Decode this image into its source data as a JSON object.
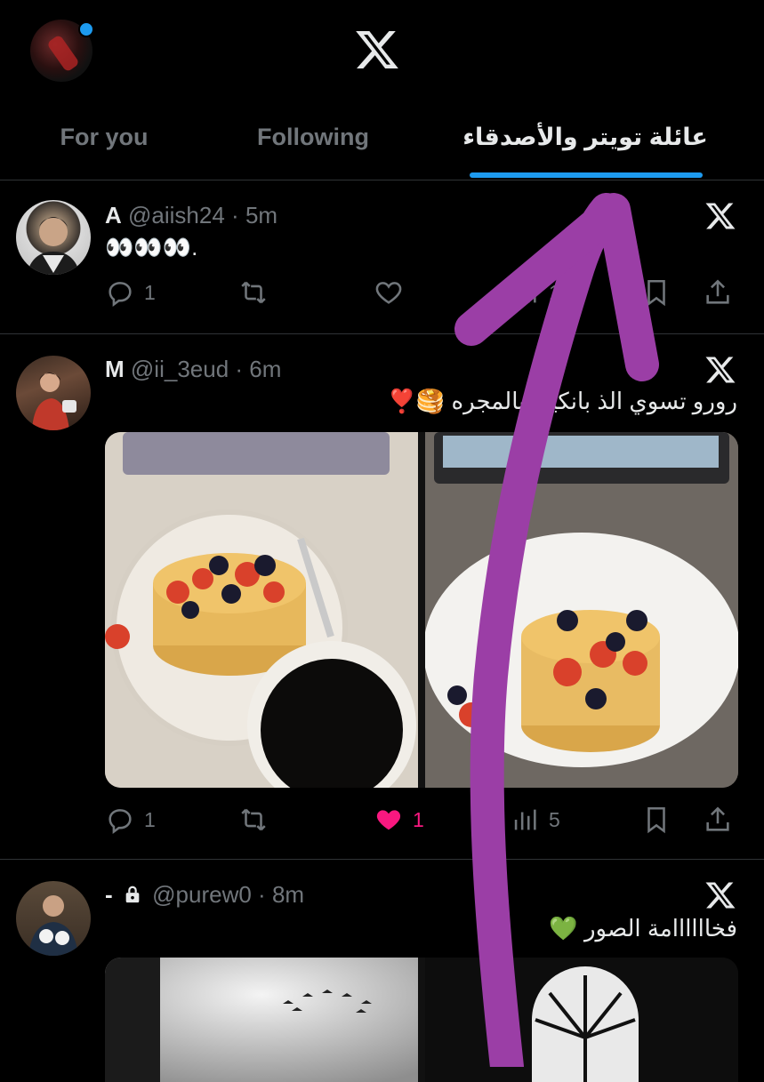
{
  "header": {
    "logo": "x-logo-icon",
    "tabs": [
      {
        "label": "For you",
        "active": false
      },
      {
        "label": "Following",
        "active": false
      },
      {
        "label": "عائلة تويتر والأصدقاء",
        "active": true
      }
    ]
  },
  "tweets": [
    {
      "name": "A",
      "handle": "@aiish24",
      "time": "5m",
      "text": "👀👀👀.",
      "replies": "1",
      "likes": "",
      "views": "12"
    },
    {
      "name": "M",
      "handle": "@ii_3eud",
      "time": "6m",
      "text": "رورو تسوي الذ بانكيك بالمجره 🥞❣️",
      "replies": "1",
      "likes": "1",
      "views": "5"
    },
    {
      "name": "-",
      "handle": "@purew0",
      "time": "8m",
      "text": "فخاااااامة الصور 💚"
    }
  ],
  "colors": {
    "accent": "#1d9bf0",
    "like": "#f91880",
    "annotation": "#9b3ea6"
  }
}
